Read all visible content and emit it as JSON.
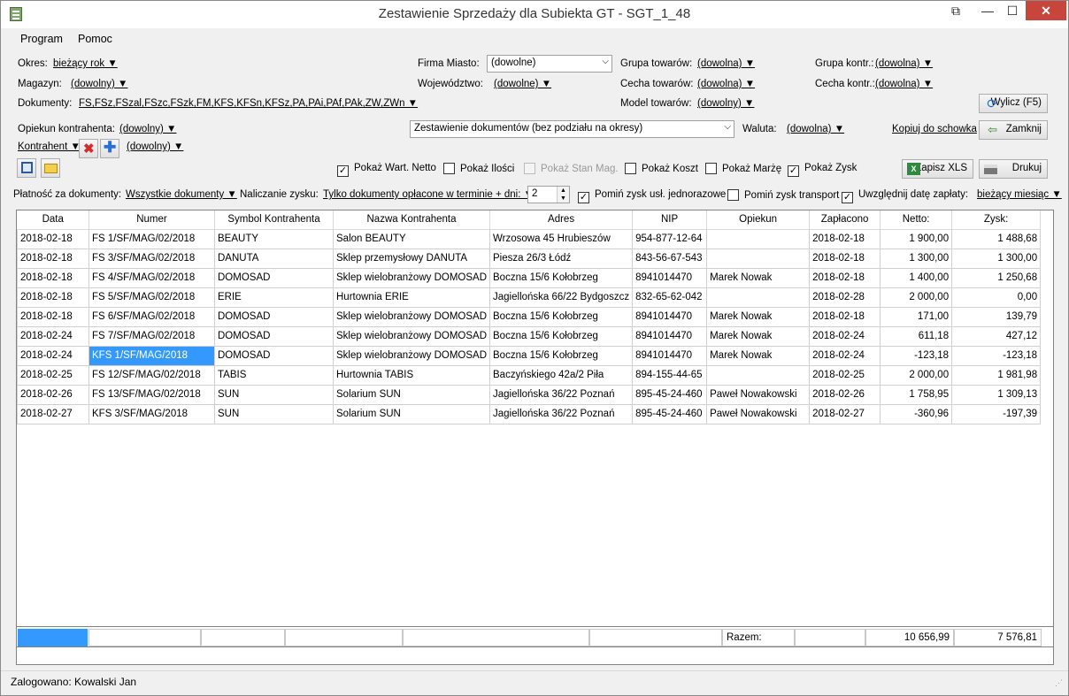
{
  "window": {
    "title": "Zestawienie Sprzedaży dla Subiekta GT - SGT_1_48"
  },
  "menu": {
    "program": "Program",
    "pomoc": "Pomoc"
  },
  "filters": {
    "okres_label": "Okres:",
    "okres_value": "bieżący rok ▼",
    "magazyn_label": "Magazyn:",
    "magazyn_value": "(dowolny) ▼",
    "dokumenty_label": "Dokumenty:",
    "dokumenty_value": "FS,FSz,FSzal,FSzc,FSzk,FM,KFS,KFSn,KFSz,PA,PAi,PAf,PAk,ZW,ZWn ▼",
    "firma_miasto_label": "Firma Miasto:",
    "firma_miasto_value": "(dowolne)",
    "wojewodztwo_label": "Województwo:",
    "wojewodztwo_value": "(dowolne) ▼",
    "grupa_towarow_label": "Grupa towarów:",
    "grupa_towarow_value": "(dowolna) ▼",
    "cecha_towarow_label": "Cecha towarów:",
    "cecha_towarow_value": "(dowolna) ▼",
    "model_towarow_label": "Model towarów:",
    "model_towarow_value": "(dowolny) ▼",
    "grupa_kontr_label": "Grupa kontr.:",
    "grupa_kontr_value": "(dowolna) ▼",
    "cecha_kontr_label": "Cecha kontr.:",
    "cecha_kontr_value": "(dowolna) ▼",
    "opiekun_label": "Opiekun kontrahenta:",
    "opiekun_value": "(dowolny) ▼",
    "kontrahent_label": "Kontrahent ▼",
    "kontrahent_value": "(dowolny) ▼",
    "zestawienie_value": "Zestawienie dokumentów (bez podziału na okresy)",
    "waluta_label": "Waluta:",
    "waluta_value": "(dowolna) ▼"
  },
  "buttons": {
    "wylicz": "Wylicz (F5)",
    "kopiuj": "Kopiuj do schowka",
    "zamknij": "Zamknij",
    "zapisz_xls": "Zapisz XLS",
    "drukuj": "Drukuj"
  },
  "checkboxes": {
    "wart_netto": "Pokaż Wart. Netto",
    "ilosci": "Pokaż Ilości",
    "stan_mag": "Pokaż Stan Mag.",
    "koszt": "Pokaż Koszt",
    "marze": "Pokaż Marżę",
    "zysk": "Pokaż Zysk"
  },
  "options": {
    "platnosc_label": "Płatność za dokumenty:",
    "platnosc_value": "Wszystkie dokumenty ▼",
    "naliczanie_label": "Naliczanie zysku:",
    "naliczanie_value": "Tylko dokumenty opłacone w terminie + dni: ▼",
    "dni_value": "2",
    "pomin_uslugi": "Pomiń zysk usł. jednorazowe",
    "pomin_transport": "Pomiń zysk transport",
    "uwzglednij": "Uwzględnij datę zapłaty:",
    "data_zaplaty_value": "bieżący miesiąc ▼"
  },
  "table": {
    "headers": [
      "Data",
      "Numer",
      "Symbol Kontrahenta",
      "Nazwa Kontrahenta",
      "Adres",
      "NIP",
      "Opiekun",
      "Zapłacono",
      "Netto:",
      "Zysk:"
    ],
    "rows": [
      [
        "2018-02-18",
        "FS 1/SF/MAG/02/2018",
        "BEAUTY",
        "Salon BEAUTY",
        "Wrzosowa  45  Hrubieszów",
        "954-877-12-64",
        "",
        "2018-02-18",
        "1 900,00",
        "1 488,68"
      ],
      [
        "2018-02-18",
        "FS 3/SF/MAG/02/2018",
        "DANUTA",
        "Sklep przemysłowy DANUTA",
        "Piesza  26/3  Łódź",
        "843-56-67-543",
        "",
        "2018-02-18",
        "1 300,00",
        "1 300,00"
      ],
      [
        "2018-02-18",
        "FS 4/SF/MAG/02/2018",
        "DOMOSAD",
        "Sklep wielobranżowy DOMOSAD",
        "Boczna  15/6  Kołobrzeg",
        "8941014470",
        "Marek Nowak",
        "2018-02-18",
        "1 400,00",
        "1 250,68"
      ],
      [
        "2018-02-18",
        "FS 5/SF/MAG/02/2018",
        "ERIE",
        "Hurtownia ERIE",
        "Jagiellońska  66/22  Bydgoszcz",
        "832-65-62-042",
        "",
        "2018-02-28",
        "2 000,00",
        "0,00"
      ],
      [
        "2018-02-18",
        "FS 6/SF/MAG/02/2018",
        "DOMOSAD",
        "Sklep wielobranżowy DOMOSAD",
        "Boczna  15/6  Kołobrzeg",
        "8941014470",
        "Marek Nowak",
        "2018-02-18",
        "171,00",
        "139,79"
      ],
      [
        "2018-02-24",
        "FS 7/SF/MAG/02/2018",
        "DOMOSAD",
        "Sklep wielobranżowy DOMOSAD",
        "Boczna  15/6  Kołobrzeg",
        "8941014470",
        "Marek Nowak",
        "2018-02-24",
        "611,18",
        "427,12"
      ],
      [
        "2018-02-24",
        "KFS 1/SF/MAG/2018",
        "DOMOSAD",
        "Sklep wielobranżowy DOMOSAD",
        "Boczna  15/6  Kołobrzeg",
        "8941014470",
        "Marek Nowak",
        "2018-02-24",
        "-123,18",
        "-123,18"
      ],
      [
        "2018-02-25",
        "FS 12/SF/MAG/02/2018",
        "TABIS",
        "Hurtownia TABIS",
        "Baczyńskiego  42a/2  Piła",
        "894-155-44-65",
        "",
        "2018-02-25",
        "2 000,00",
        "1 981,98"
      ],
      [
        "2018-02-26",
        "FS 13/SF/MAG/02/2018",
        "SUN",
        "Solarium SUN",
        "Jagiellońska  36/22  Poznań",
        "895-45-24-460",
        "Paweł Nowakowski",
        "2018-02-26",
        "1 758,95",
        "1 309,13"
      ],
      [
        "2018-02-27",
        "KFS 3/SF/MAG/2018",
        "SUN",
        "Solarium SUN",
        "Jagiellońska  36/22  Poznań",
        "895-45-24-460",
        "Paweł Nowakowski",
        "2018-02-27",
        "-360,96",
        "-197,39"
      ]
    ],
    "footer": {
      "label": "Razem:",
      "netto": "10 656,99",
      "zysk": "7 576,81"
    }
  },
  "status": {
    "user": "Zalogowano: Kowalski Jan"
  }
}
